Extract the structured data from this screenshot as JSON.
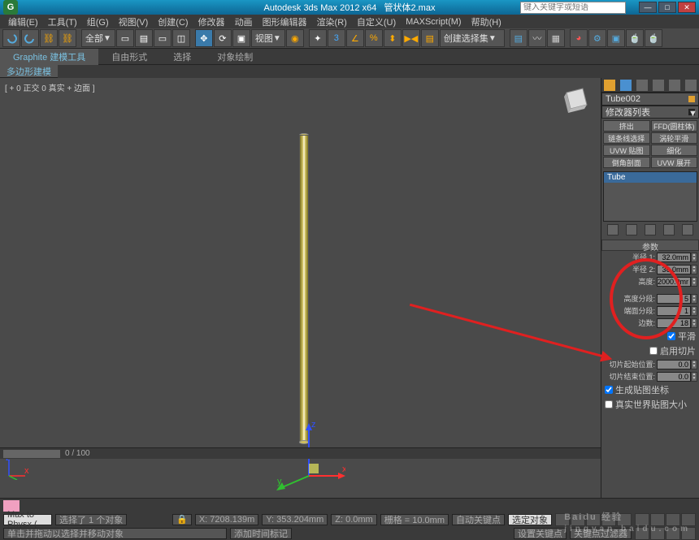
{
  "window": {
    "app_title": "Autodesk 3ds Max 2012 x64",
    "doc_title": "管状体2.max",
    "search_placeholder": "键入关键字或短语"
  },
  "menu": [
    "编辑(E)",
    "工具(T)",
    "组(G)",
    "视图(V)",
    "创建(C)",
    "修改器",
    "动画",
    "图形编辑器",
    "渲染(R)",
    "自定义(U)",
    "MAXScript(M)",
    "帮助(H)"
  ],
  "toolbar": {
    "selection_set": "全部",
    "view_label": "视图",
    "modeling_label": "创建选择集"
  },
  "ribbon": {
    "tabs": [
      "Graphite 建模工具",
      "自由形式",
      "选择",
      "对象绘制"
    ],
    "subtab": "多边形建模"
  },
  "viewport": {
    "label": "[ + 0 正交 0 真实 + 边面 ]"
  },
  "timeline": {
    "range": "0 / 100"
  },
  "modify": {
    "object_name": "Tube002",
    "modifier_list": "修改器列表",
    "buttons": [
      "挤出",
      "FFD(圆柱体)",
      "链条线选择",
      "涡轮平滑",
      "UVW 贴图",
      "细化",
      "倒角剖面",
      "UVW 展开"
    ],
    "stack_item": "Tube",
    "rollout_title": "参数",
    "params": {
      "radius1_label": "半径 1:",
      "radius1_value": "32.0mm",
      "radius2_label": "半径 2:",
      "radius2_value": "36.0mm",
      "height_label": "高度:",
      "height_value": "2000.0mm",
      "height_segs_label": "高度分段:",
      "height_segs_value": "5",
      "cap_segs_label": "端面分段:",
      "cap_segs_value": "1",
      "sides_label": "边数:",
      "sides_value": "18",
      "smooth_label": "平滑",
      "slice_on_label": "启用切片",
      "slice_from_label": "切片起始位置:",
      "slice_from_value": "0.0",
      "slice_to_label": "切片结束位置:",
      "slice_to_value": "0.0",
      "gen_map_label": "生成贴图坐标",
      "real_world_label": "真实世界贴图大小"
    }
  },
  "status": {
    "maxscript": "Max to Physx (",
    "selected": "选择了 1 个对象",
    "prompt": "单击并拖动以选择并移动对象",
    "x": "X: 7208.139m",
    "y": "Y: 353.204mm",
    "z": "Z: 0.0mm",
    "grid": "栅格 = 10.0mm",
    "autokey": "自动关键点",
    "selected_filter": "选定对象",
    "setkey": "设置关键点",
    "keyfilter": "关键点过滤器",
    "addtime": "添加时间标记"
  },
  "watermark": {
    "brand": "Baidu 经验",
    "url": "jingyan.baidu.com"
  }
}
